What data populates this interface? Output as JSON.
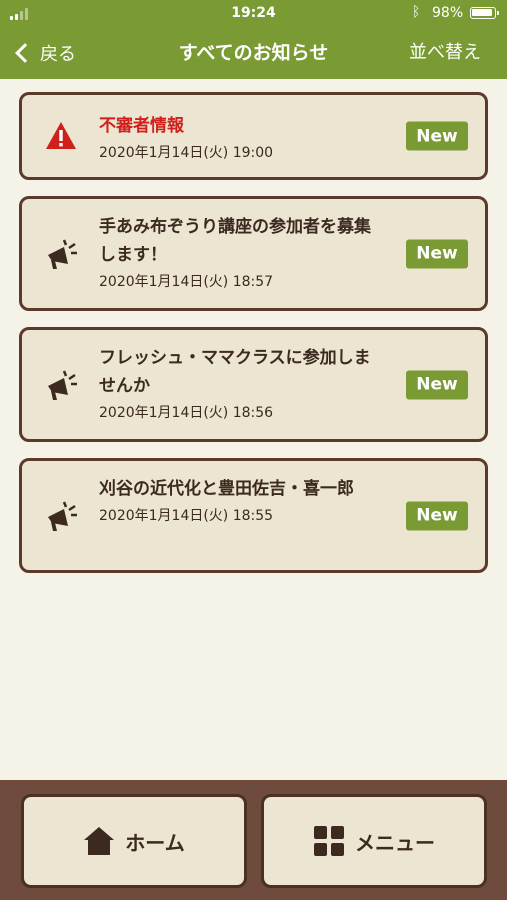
{
  "status_bar": {
    "time": "19:24",
    "battery": "98%"
  },
  "nav": {
    "back_label": "戻る",
    "title": "すべてのお知らせ",
    "sort_label": "並べ替え"
  },
  "notices": [
    {
      "title": "不審者情報",
      "date": "2020年1月14日(火) 19:00",
      "badge": "New",
      "icon": "warning-icon",
      "alert": true
    },
    {
      "title": "手あみ布ぞうり講座の参加者を募集します！",
      "date": "2020年1月14日(火) 18:57",
      "badge": "New",
      "icon": "megaphone-icon",
      "alert": false
    },
    {
      "title": "フレッシュ・ママクラスに参加しませんか",
      "date": "2020年1月14日(火) 18:56",
      "badge": "New",
      "icon": "megaphone-icon",
      "alert": false
    },
    {
      "title": "刈谷の近代化と豊田佐吉・喜一郎",
      "date": "2020年1月14日(火) 18:55",
      "badge": "New",
      "icon": "megaphone-icon",
      "alert": false
    }
  ],
  "bottom": {
    "home_label": "ホーム",
    "menu_label": "メニュー"
  },
  "colors": {
    "header_green": "#7a9a34",
    "alert_red": "#d0201c",
    "card_border": "#5b3a2c",
    "footer_brown": "#6e4b3c"
  }
}
